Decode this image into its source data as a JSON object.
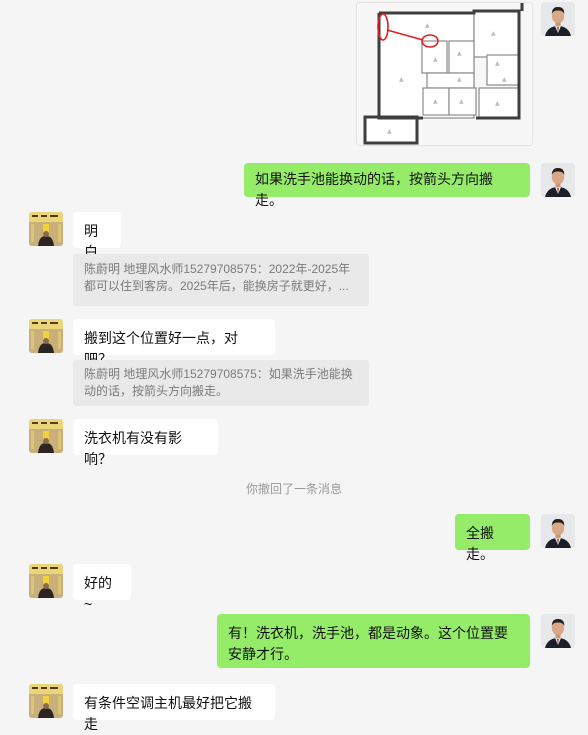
{
  "messages": {
    "m1_image": {
      "alt": "floor plan"
    },
    "m2": "如果洗手池能换动的话，按箭头方向搬走。",
    "m3": "明白",
    "q3": "陈蔚明 地理风水师15279708575：2022年-2025年都可以住到客房。2025年后，能换房子就更好，...",
    "m4": "搬到这个位置好一点，对吧？",
    "q4": "陈蔚明 地理风水师15279708575：如果洗手池能换动的话，按箭头方向搬走。",
    "m5": "洗衣机有没有影响？",
    "system": "你撤回了一条消息",
    "m6": "全搬走。",
    "m7": "好的~",
    "m8": "有！洗衣机，洗手池，都是动象。这个位置要安静才行。",
    "m9": "有条件空调主机最好把它搬走"
  },
  "colors": {
    "bg": "#f5f5f5",
    "self_bubble": "#95ec69",
    "other_bubble": "#ffffff",
    "quote_bg": "#e9e9e9",
    "annotation": "#e02020"
  },
  "icons": {
    "self_avatar": "man-portrait-avatar",
    "other_avatar": "yellow-calligraphy-avatar"
  }
}
